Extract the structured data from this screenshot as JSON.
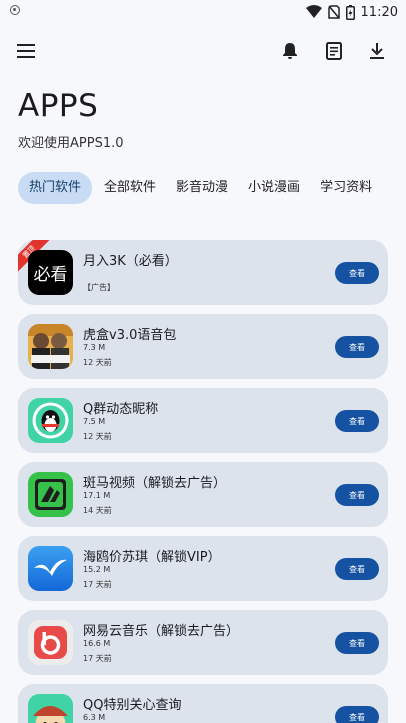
{
  "status_bar": {
    "time": "11:20"
  },
  "header": {
    "title": "APPS",
    "subtitle": "欢迎使用APPS1.0"
  },
  "tabs": [
    {
      "label": "热门软件",
      "active": true
    },
    {
      "label": "全部软件",
      "active": false
    },
    {
      "label": "影音动漫",
      "active": false
    },
    {
      "label": "小说漫画",
      "active": false
    },
    {
      "label": "学习资料",
      "active": false
    }
  ],
  "apps": [
    {
      "name": "月入3K（必看）",
      "ad_label": "【广告】",
      "ribbon": "置顶",
      "thumb_text": "必看",
      "button": "查看",
      "icon": "must-see-icon"
    },
    {
      "name": "虎盒v3.0语音包",
      "size": "7.3 M",
      "time": "12 天前",
      "button": "查看",
      "icon": "huhe-avatar-icon"
    },
    {
      "name": "Q群动态昵称",
      "size": "7.5 M",
      "time": "12 天前",
      "button": "查看",
      "icon": "qq-penguin-icon"
    },
    {
      "name": "斑马视频（解锁去广告）",
      "size": "17.1 M",
      "time": "14 天前",
      "button": "查看",
      "icon": "zebra-video-icon"
    },
    {
      "name": "海鸥价苏琪（解锁VIP）",
      "size": "15.2 M",
      "time": "17 天前",
      "button": "查看",
      "icon": "seagull-icon"
    },
    {
      "name": "网易云音乐（解锁去广告）",
      "size": "16.6 M",
      "time": "17 天前",
      "button": "查看",
      "icon": "netease-music-icon"
    },
    {
      "name": "QQ特别关心查询",
      "size": "6.3 M",
      "time": "",
      "button": "查看",
      "icon": "cartoon-face-icon"
    }
  ],
  "colors": {
    "accent": "#1553a2",
    "tab_active_bg": "#c9dcf3",
    "card_bg": "#dde3ed",
    "ribbon": "#e0342c"
  }
}
